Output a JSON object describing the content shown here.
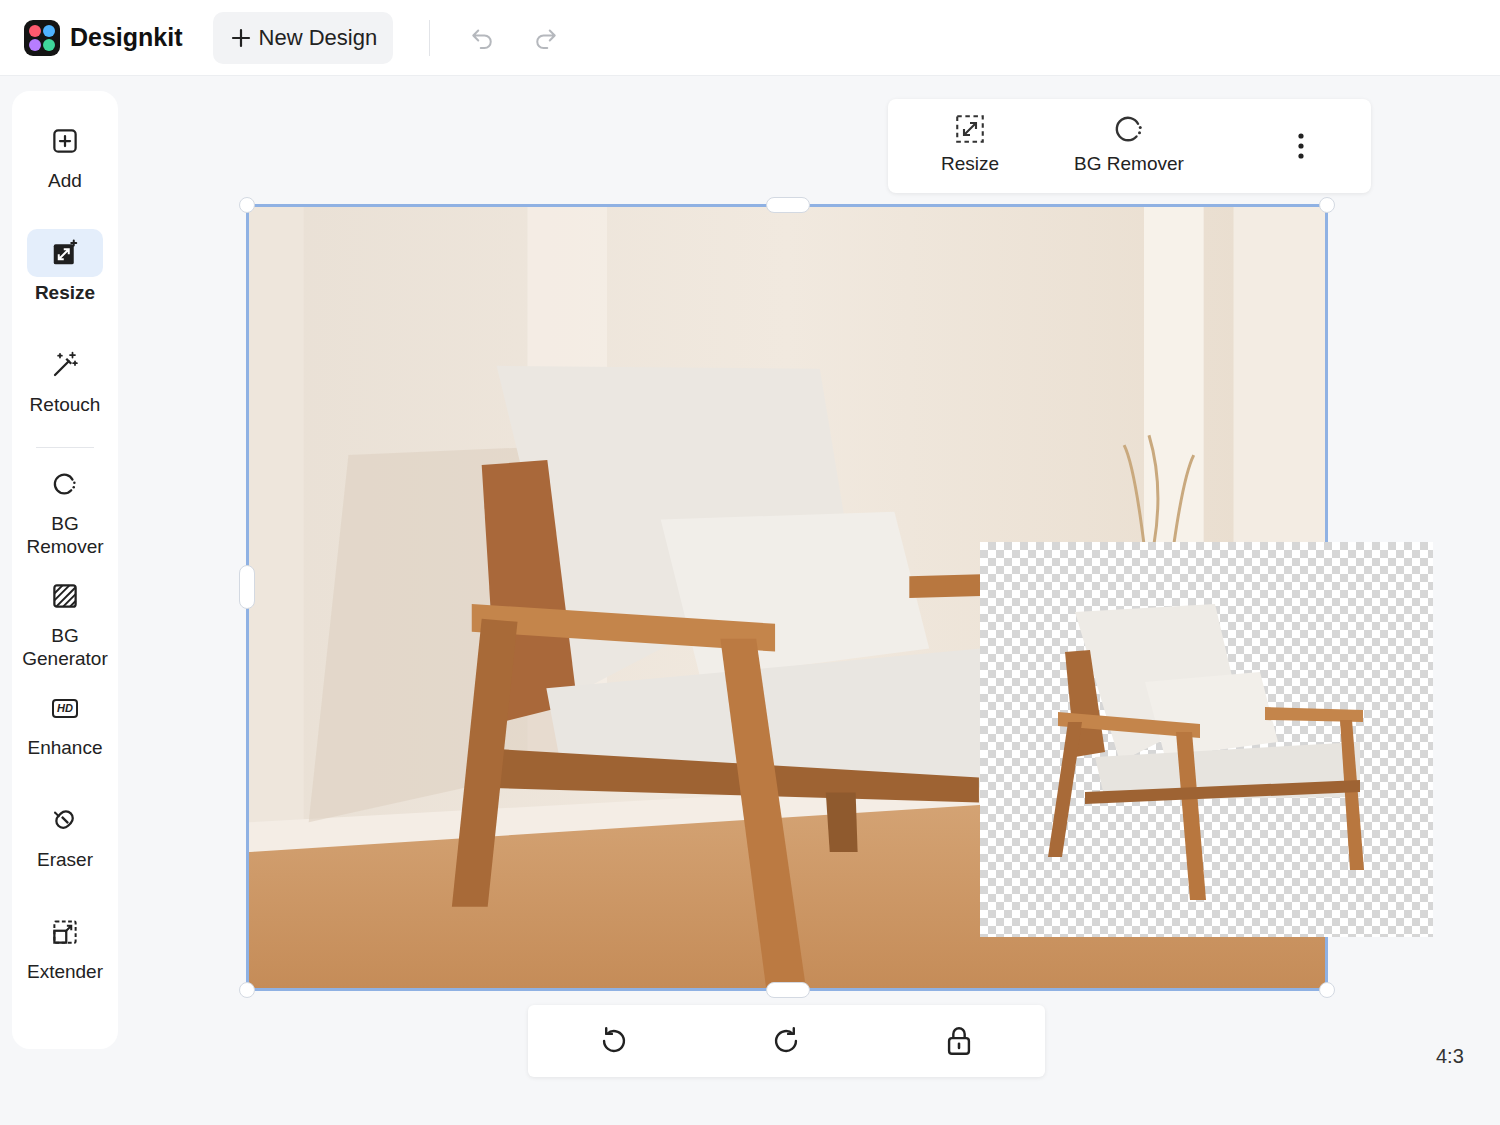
{
  "app": {
    "name": "Designkit"
  },
  "header": {
    "new_design": "New Design"
  },
  "sidebar": {
    "items": [
      {
        "label": "Add",
        "selected": false
      },
      {
        "label": "Resize",
        "selected": true
      },
      {
        "label": "Retouch",
        "selected": false
      },
      {
        "label": "BG Remover",
        "selected": false
      },
      {
        "label": "BG Generator",
        "selected": false
      },
      {
        "label": "Enhance",
        "selected": false,
        "icon_text": "HD"
      },
      {
        "label": "Eraser",
        "selected": false
      },
      {
        "label": "Extender",
        "selected": false
      }
    ]
  },
  "context_toolbar": {
    "items": [
      {
        "label": "Resize"
      },
      {
        "label": "BG Remover"
      }
    ]
  },
  "canvas": {
    "aspect_ratio": "4:3"
  }
}
